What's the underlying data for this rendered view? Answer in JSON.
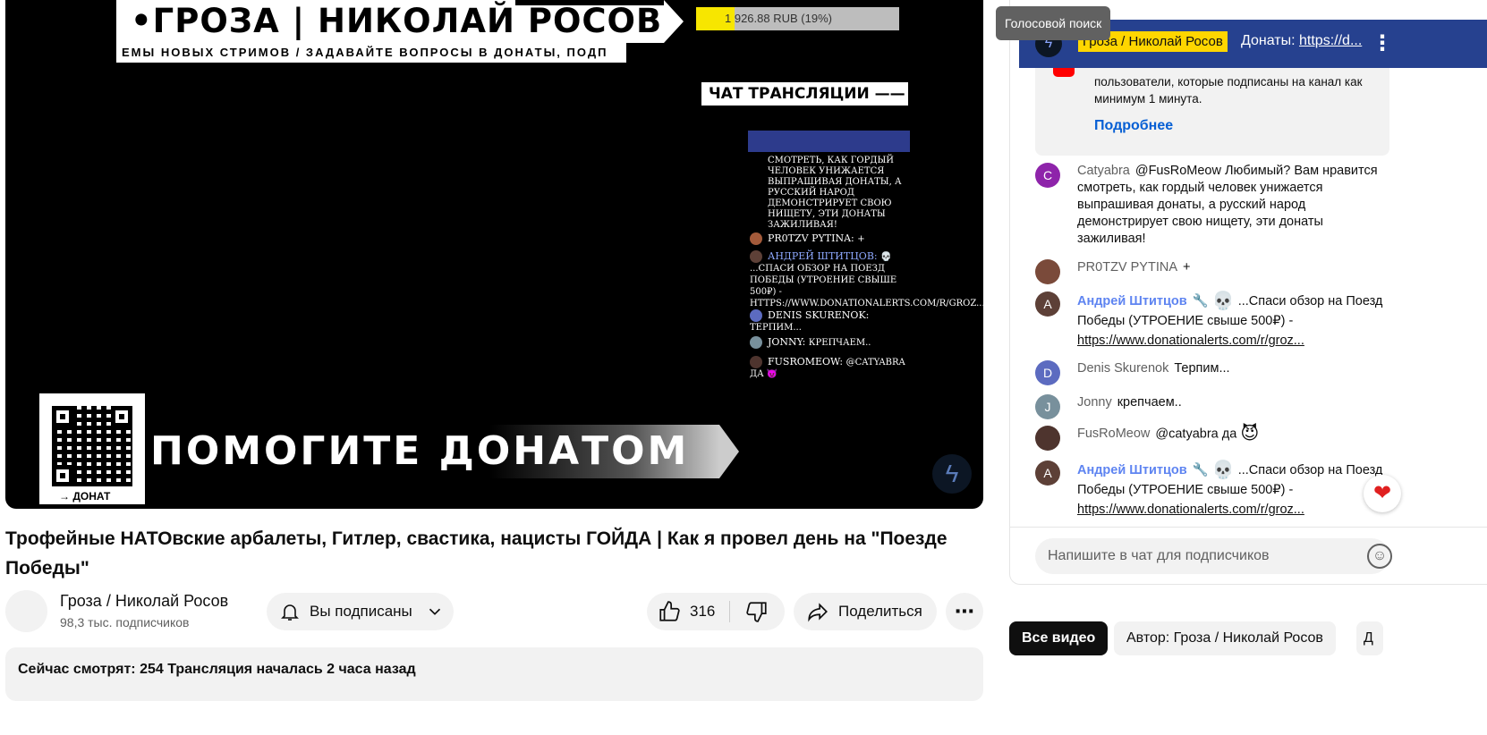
{
  "video": {
    "overlay_title": "•ГРОЗА | НИКОЛАЙ РОСОВ",
    "donation_progress_text": "1 926.88 RUB (19%)",
    "donation_progress_fraction": 0.19,
    "ticker_text": "ЕМЫ НОВЫХ СТРИМОВ / ЗАДАВАЙТЕ ВОПРОСЫ В ДОНАТЫ, ПОДП",
    "chat_label": "ЧАТ ТРАНСЛЯЦИИ ——",
    "overlay_chat": {
      "first_message": "смотреть, как гордый человек унижается выпрашивая донаты, а русский народ демонстрирует свою нищету, эти донаты зажиливая!",
      "rows": [
        {
          "name": "PR0TZV PYTINA:",
          "text": "+"
        },
        {
          "name": "АНДРЕЙ ШТИТЦОВ:",
          "text": "💀 ...Спаси обзор на Поезд Победы (УТРОЕНИЕ свыше 500₽) - https://www.donationalerts.com/r/groz..."
        },
        {
          "name": "DENIS SKURENOK:",
          "text": "Терпим..."
        },
        {
          "name": "JONNY:",
          "text": "крепчаем.."
        },
        {
          "name": "FUSROMEOW:",
          "text": "@catyabra да 😈"
        }
      ]
    },
    "qr_caption": "→ ДОНАТ",
    "donate_banner": "ПОМОГИТЕ ДОНАТОМ",
    "title": "Трофейные НАТОвские арбалеты, Гитлер, свастика, нацисты ГОЙДА | Как я провел день на \"Поезде Победы\""
  },
  "channel": {
    "name": "Гроза / Николай Росов",
    "subscribers": "98,3 тыс. подписчиков",
    "subscribe_label": "Вы подписаны"
  },
  "actions": {
    "likes": "316",
    "share_label": "Поделиться"
  },
  "description": {
    "text": "Сейчас смотрят: 254  Трансляция началась 2 часа назад"
  },
  "chat": {
    "tooltip": "Голосовой поиск",
    "pinned": {
      "author": "Гроза / Николай Росов",
      "text_prefix": "Донаты: ",
      "link": "https://d..."
    },
    "notice": {
      "text": "пользователи, которые подписаны на канал как минимум 1 минута.",
      "more": "Подробнее"
    },
    "messages": [
      {
        "author": "Catyabra",
        "avatar_letter": "C",
        "avatar_color": "#8e24aa",
        "text": "@FusRoMeow Любимый? Вам нравится смотреть, как гордый человек унижается выпрашивая донаты, а русский народ демонстрирует свою нищету, эти донаты зажиливая!"
      },
      {
        "author": "PR0TZV PYTINA",
        "avatar_letter": "",
        "avatar_color": "#7a4a3a",
        "text": "+"
      },
      {
        "author": "Андрей Штитцов",
        "avatar_letter": "A",
        "avatar_color": "#5d4037",
        "moderator": true,
        "text": "...Спаси обзор на Поезд Победы (УТРОЕНИЕ свыше 500₽) - ",
        "link": "https://www.donationalerts.com/r/groz..."
      },
      {
        "author": "Denis Skurenok",
        "avatar_letter": "D",
        "avatar_color": "#5c6bc0",
        "text": "Терпим..."
      },
      {
        "author": "Jonny",
        "avatar_letter": "J",
        "avatar_color": "#78909c",
        "text": "крепчаем.."
      },
      {
        "author": "FusRoMeow",
        "avatar_letter": "",
        "avatar_color": "#4e342e",
        "text": "@catyabra да"
      },
      {
        "author": "Андрей Штитцов",
        "avatar_letter": "A",
        "avatar_color": "#5d4037",
        "moderator": true,
        "text": "...Спаси обзор на Поезд Победы (УТРОЕНИЕ свыше 500₽) - ",
        "link": "https://www.donationalerts.com/r/groz..."
      }
    ],
    "input_placeholder": "Напишите в чат для подписчиков"
  },
  "chips": {
    "all": "Все видео",
    "author": "Автор: Гроза / Николай Росов",
    "cut": "Д"
  },
  "colors": {
    "pinned_bg": "#26418f",
    "highlight": "#ffd600",
    "link_blue": "#065fd4",
    "moderator": "#5e84f1"
  }
}
